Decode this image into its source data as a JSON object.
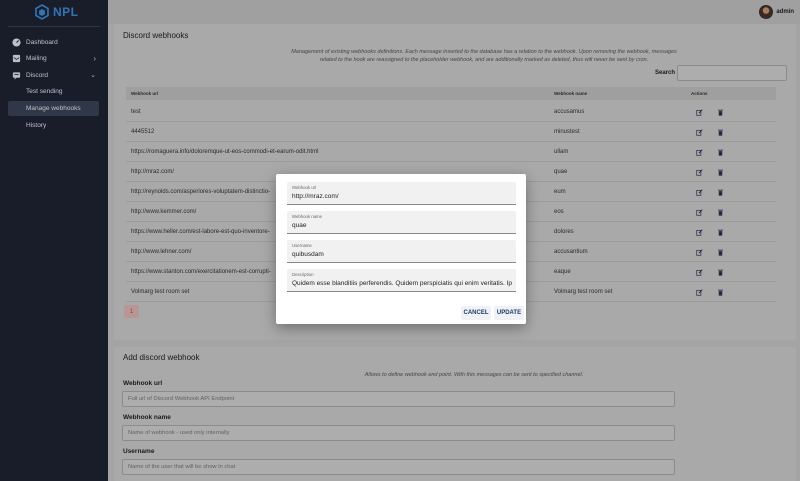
{
  "app": {
    "logo_text": "NPL"
  },
  "user": {
    "name": "admin"
  },
  "sidebar": {
    "items": [
      {
        "label": "Dashboard"
      },
      {
        "label": "Mailing"
      },
      {
        "label": "Discord"
      }
    ],
    "sub_items": [
      {
        "label": "Test sending"
      },
      {
        "label": "Manage webhooks"
      },
      {
        "label": "History"
      }
    ]
  },
  "webhooks": {
    "title": "Discord webhooks",
    "description_line1": "Management of existing webhooks definitions. Each message inserted to the database has a relation to the webhook. Upon removing the webhook, messages",
    "description_line2": "related to the hook are reassigned to the placeholder webhook, and are additionally marked as deleted, thus will never be sent by cron.",
    "search_label": "Search",
    "columns": {
      "url": "Webhook url",
      "name": "Webhook name",
      "actions": "Actions"
    },
    "rows": [
      {
        "url": "test",
        "name": "accusamus"
      },
      {
        "url": "4445512",
        "name": "minustest"
      },
      {
        "url": "https://romaguera.info/doloremque-ut-eos-commodi-et-earum-odit.html",
        "name": "ullam"
      },
      {
        "url": "http://mraz.com/",
        "name": "quae"
      },
      {
        "url": "http://reynolds.com/asperiores-voluptatem-distinctio-",
        "name": "eum"
      },
      {
        "url": "http://www.kemmer.com/",
        "name": "eos"
      },
      {
        "url": "https://www.heller.com/est-labore-est-quo-inventore-",
        "name": "dolores"
      },
      {
        "url": "http://www.lehner.com/",
        "name": "accusantium"
      },
      {
        "url": "https://www.stanton.com/exercitationem-est-corrupti-",
        "name": "eaque"
      },
      {
        "url": "Volmarg test room set",
        "name": "Volmarg test room set"
      }
    ],
    "page": "1"
  },
  "add_webhook": {
    "title": "Add discord webhook",
    "description": "Allows to define webhook end point. With this messages can be sent to specified channel.",
    "url_label": "Webhook url",
    "url_placeholder": "Full url of Discord Webhook API Endpoint",
    "name_label": "Webhook name",
    "name_placeholder": "Name of webhook - used only internally",
    "username_label": "Username",
    "username_placeholder": "Name of the user that will be show in chat"
  },
  "modal": {
    "fields": [
      {
        "label": "Webhook url",
        "value": "http://mraz.com/"
      },
      {
        "label": "Webhook name",
        "value": "quae"
      },
      {
        "label": "Username",
        "value": "quibusdam"
      },
      {
        "label": "Description",
        "value": "Quidem esse blanditiis perferendis. Quidem perspiciatis qui enim veritatis. Ipsa dignissimos"
      }
    ],
    "cancel_label": "CANCEL",
    "update_label": "UPDATE"
  },
  "colors": {
    "sidebar_bg": "#1e2433",
    "accent": "#3d8fe0",
    "button_text": "#1e3a64",
    "page_active": "#c44444"
  },
  "icons": [
    "dashboard-icon",
    "mail-icon",
    "discord-icon",
    "chevron-right-icon",
    "chevron-down-icon",
    "edit-icon",
    "trash-icon"
  ]
}
